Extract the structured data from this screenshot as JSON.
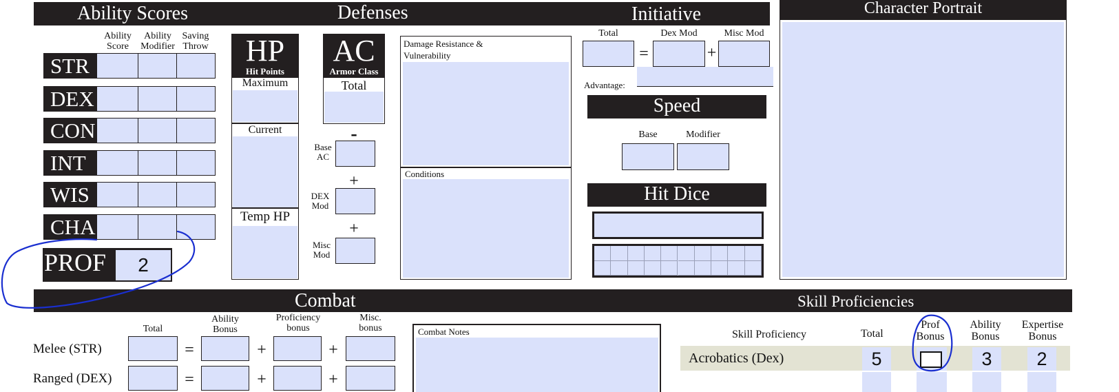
{
  "headers": {
    "ability_scores": "Ability Scores",
    "defenses": "Defenses",
    "initiative": "Initiative",
    "character_portrait": "Character Portrait",
    "speed": "Speed",
    "hit_dice": "Hit Dice",
    "combat": "Combat",
    "skill_proficiencies": "Skill Proficiencies"
  },
  "ability_columns": {
    "score": [
      "Ability",
      "Score"
    ],
    "modifier": [
      "Ability",
      "Modifier"
    ],
    "saving": [
      "Saving",
      "Throw"
    ]
  },
  "abilities": [
    "STR",
    "DEX",
    "CON",
    "INT",
    "WIS",
    "CHA"
  ],
  "prof": {
    "label": "PROF",
    "value": "2"
  },
  "hp": {
    "big": "HP",
    "sub": "Hit Points",
    "maximum": "Maximum",
    "current": "Current",
    "temp": "Temp HP"
  },
  "ac": {
    "big": "AC",
    "sub": "Armor Class",
    "total": "Total",
    "minus": "-",
    "base": [
      "Base",
      "AC"
    ],
    "dex": [
      "DEX",
      "Mod"
    ],
    "misc": [
      "Misc",
      "Mod"
    ],
    "plus": "+"
  },
  "notes": {
    "damage": "Damage Resistance & Vulnerability",
    "conditions": "Conditions"
  },
  "initiative": {
    "total": "Total",
    "dex_mod": "Dex Mod",
    "misc_mod": "Misc Mod",
    "equals": "=",
    "plus": "+",
    "advantage": "Advantage:"
  },
  "speed": {
    "base": "Base",
    "modifier": "Modifier"
  },
  "combat": {
    "col_total": "Total",
    "col_ability": [
      "Ability",
      "Bonus"
    ],
    "col_prof": [
      "Proficiency",
      "bonus"
    ],
    "col_misc": [
      "Misc.",
      "bonus"
    ],
    "equals": "=",
    "plus": "+",
    "rows": [
      "Melee (STR)",
      "Ranged (DEX)"
    ],
    "notes": "Combat Notes"
  },
  "skills": {
    "col_skill": "Skill Proficiency",
    "col_total": "Total",
    "col_prof": [
      "Prof",
      "Bonus"
    ],
    "col_ability": [
      "Ability",
      "Bonus"
    ],
    "col_expertise": [
      "Expertise",
      "Bonus"
    ],
    "rows": [
      {
        "name": "Acrobatics (Dex)",
        "total": "5",
        "ability": "3",
        "expertise": "2"
      }
    ]
  },
  "colors": {
    "dark": "#231f20",
    "field": "#dae1fb",
    "ink": "#1a2fd0",
    "skill_row": "#e3e3d3"
  }
}
